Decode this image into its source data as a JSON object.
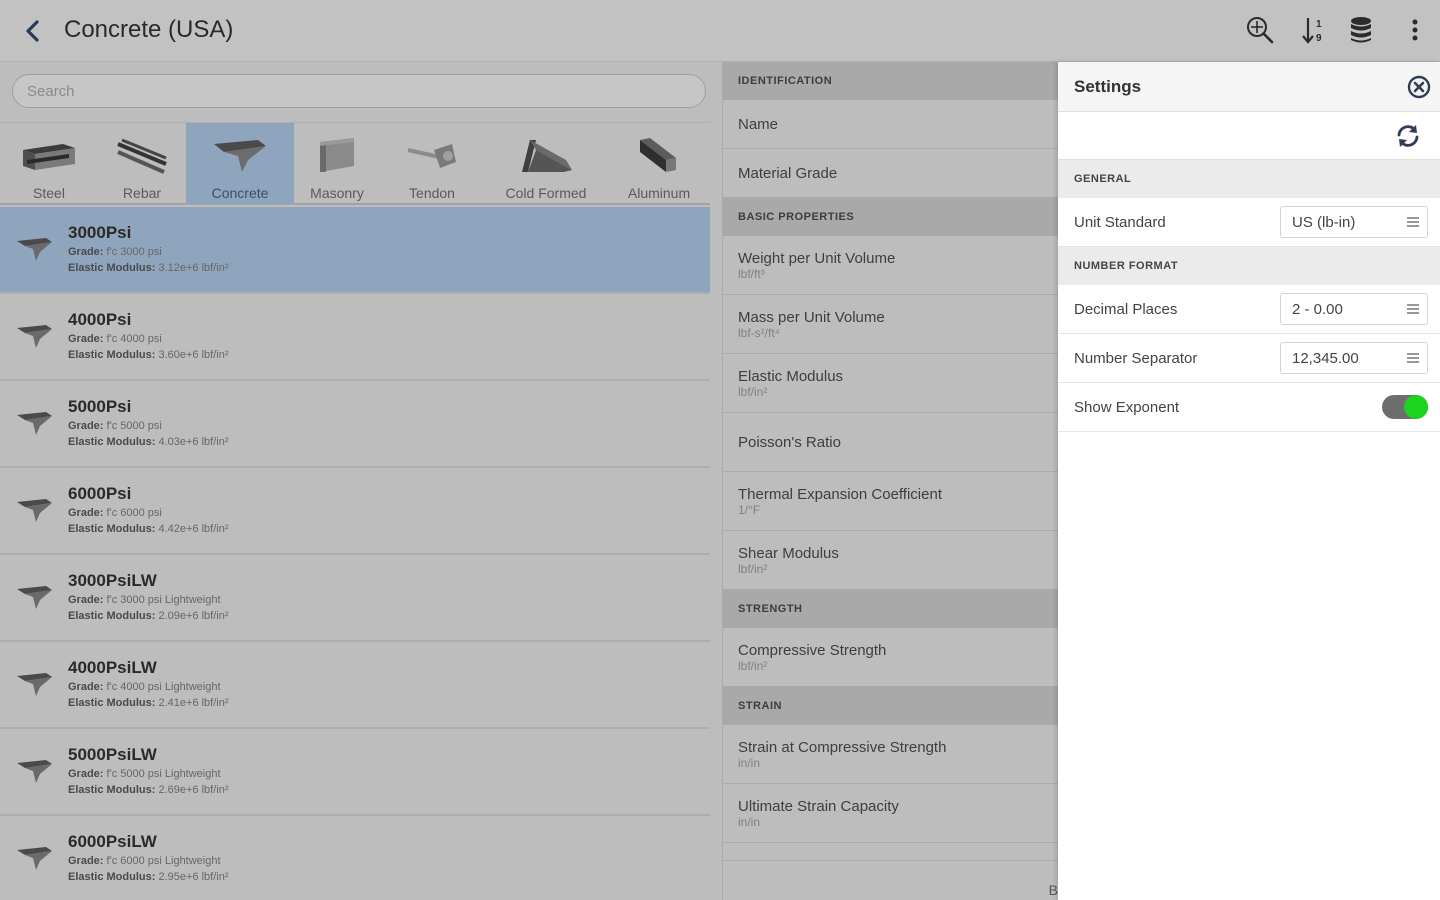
{
  "header": {
    "title": "Concrete (USA)",
    "icons": [
      "back-icon",
      "zoom-search-icon",
      "sort-numeric-icon",
      "database-icon",
      "more-vertical-icon"
    ]
  },
  "search": {
    "placeholder": "Search"
  },
  "categories": [
    {
      "label": "Steel",
      "active": false
    },
    {
      "label": "Rebar",
      "active": false
    },
    {
      "label": "Concrete",
      "active": true
    },
    {
      "label": "Masonry",
      "active": false
    },
    {
      "label": "Tendon",
      "active": false
    },
    {
      "label": "Cold Formed",
      "active": false
    },
    {
      "label": "Aluminum",
      "active": false
    }
  ],
  "materials": [
    {
      "name": "3000Psi",
      "grade_key": "Grade:",
      "grade": "f'c 3000 psi",
      "mod_key": "Elastic Modulus:",
      "modulus": "3.12e+6 lbf/in²",
      "selected": true
    },
    {
      "name": "4000Psi",
      "grade_key": "Grade:",
      "grade": "f'c 4000 psi",
      "mod_key": "Elastic Modulus:",
      "modulus": "3.60e+6 lbf/in²",
      "selected": false
    },
    {
      "name": "5000Psi",
      "grade_key": "Grade:",
      "grade": "f'c 5000 psi",
      "mod_key": "Elastic Modulus:",
      "modulus": "4.03e+6 lbf/in²",
      "selected": false
    },
    {
      "name": "6000Psi",
      "grade_key": "Grade:",
      "grade": "f'c 6000 psi",
      "mod_key": "Elastic Modulus:",
      "modulus": "4.42e+6 lbf/in²",
      "selected": false
    },
    {
      "name": "3000PsiLW",
      "grade_key": "Grade:",
      "grade": "f'c 3000 psi Lightweight",
      "mod_key": "Elastic Modulus:",
      "modulus": "2.09e+6 lbf/in²",
      "selected": false
    },
    {
      "name": "4000PsiLW",
      "grade_key": "Grade:",
      "grade": "f'c 4000 psi Lightweight",
      "mod_key": "Elastic Modulus:",
      "modulus": "2.41e+6 lbf/in²",
      "selected": false
    },
    {
      "name": "5000PsiLW",
      "grade_key": "Grade:",
      "grade": "f'c 5000 psi Lightweight",
      "mod_key": "Elastic Modulus:",
      "modulus": "2.69e+6 lbf/in²",
      "selected": false
    },
    {
      "name": "6000PsiLW",
      "grade_key": "Grade:",
      "grade": "f'c 6000 psi Lightweight",
      "mod_key": "Elastic Modulus:",
      "modulus": "2.95e+6 lbf/in²",
      "selected": false
    }
  ],
  "properties": {
    "identification": {
      "header": "IDENTIFICATION",
      "name": "Name",
      "grade": "Material Grade"
    },
    "basic": {
      "header": "BASIC PROPERTIES",
      "weight": {
        "label": "Weight per Unit Volume",
        "unit": "lbf/ft³"
      },
      "mass": {
        "label": "Mass per Unit Volume",
        "unit": "lbf-s²/ft⁴"
      },
      "elastic": {
        "label": "Elastic Modulus",
        "unit": "lbf/in²"
      },
      "poisson": {
        "label": "Poisson's Ratio"
      },
      "thermal": {
        "label": "Thermal Expansion Coefficient",
        "unit": "1/°F"
      },
      "shear": {
        "label": "Shear Modulus",
        "unit": "lbf/in²"
      }
    },
    "strength": {
      "header": "STRENGTH",
      "compressive": {
        "label": "Compressive Strength",
        "unit": "lbf/in²"
      }
    },
    "strain": {
      "header": "STRAIN",
      "at_compressive": {
        "label": "Strain at Compressive Strength",
        "unit": "in/in"
      },
      "ultimate": {
        "label": "Ultimate Strain Capacity",
        "unit": "in/in"
      }
    },
    "footer_char": "B"
  },
  "settings": {
    "title": "Settings",
    "general_header": "GENERAL",
    "unit_standard": {
      "label": "Unit Standard",
      "value": "US (lb-in)"
    },
    "number_format_header": "NUMBER FORMAT",
    "decimal_places": {
      "label": "Decimal Places",
      "value": "2 - 0.00"
    },
    "number_separator": {
      "label": "Number Separator",
      "value": "12,345.00"
    },
    "show_exponent": {
      "label": "Show Exponent",
      "on": true
    },
    "toggle_color": "#1ed31e"
  }
}
